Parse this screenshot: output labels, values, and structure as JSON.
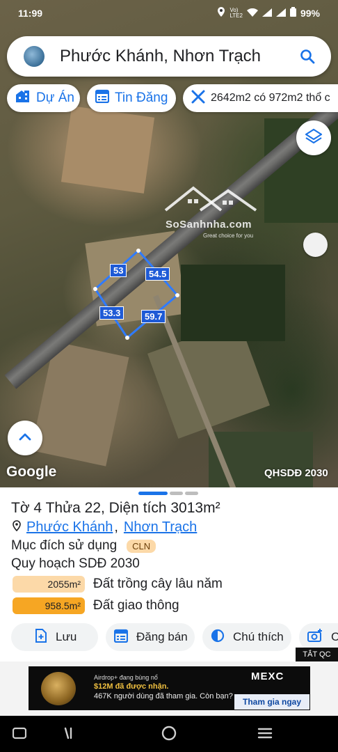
{
  "status_bar": {
    "time": "11:99",
    "battery": "99%"
  },
  "search": {
    "query": "Phước Khánh, Nhơn Trạch"
  },
  "chips": [
    {
      "label": "Dự Án"
    },
    {
      "label": "Tin Đăng"
    },
    {
      "label": "2642m2 có 972m2 thổ c"
    }
  ],
  "map": {
    "watermark_name": "SoSanhnha.com",
    "watermark_sub": "Great choice for you",
    "parcel_edges": [
      "53",
      "54.5",
      "53.3",
      "59.7"
    ],
    "google_label": "Google",
    "layer_label": "QHSDĐ 2030"
  },
  "sheet": {
    "title": "Tờ 4 Thửa 22, Diện tích 3013m²",
    "ward": "Phước Khánh",
    "separator": ",",
    "district": "Nhơn Trạch",
    "purpose_label": "Mục đích sử dụng",
    "purpose_code": "CLN",
    "plan_label": "Quy hoạch SDĐ 2030",
    "zones": [
      {
        "area": "2055m²",
        "name": "Đất trồng cây lâu năm",
        "color": "#fcd9a8"
      },
      {
        "area": "958.5m²",
        "name": "Đất giao thông",
        "color": "#f6a623"
      }
    ],
    "actions": [
      {
        "label": "Lưu"
      },
      {
        "label": "Đăng bán"
      },
      {
        "label": "Chú thích"
      },
      {
        "label": "C"
      }
    ],
    "ad_close": "TẮT QC"
  },
  "ad": {
    "line1": "Airdrop+ đang bùng nổ",
    "line2": "$12M đã được nhận.",
    "line3": "467K người dùng đã tham gia. Còn bạn?",
    "brand": "MEXC",
    "cta": "Tham gia ngay"
  },
  "colors": {
    "accent": "#1a73e8",
    "parcel": "#1e5ad6"
  }
}
